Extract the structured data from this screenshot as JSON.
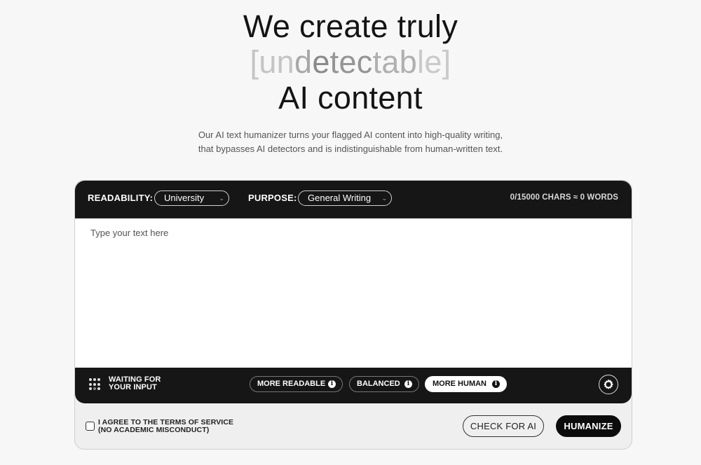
{
  "hero": {
    "line1": "We create truly",
    "accent": {
      "open": "[",
      "parts": [
        "un",
        "d",
        "e",
        "tec",
        "t",
        "ab",
        "le"
      ],
      "close": "]"
    },
    "line3": "AI content"
  },
  "subtitle": {
    "line1": "Our AI text humanizer turns your flagged AI content into high-quality writing,",
    "line2": "that bypasses AI detectors and is indistinguishable from human-written text."
  },
  "toolbar": {
    "readability_label": "READABILITY:",
    "readability_value": "University",
    "purpose_label": "PURPOSE:",
    "purpose_value": "General Writing",
    "counter": "0/15000 CHARS ≈ 0 WORDS"
  },
  "editor": {
    "placeholder": "Type your text here",
    "value": ""
  },
  "status": {
    "line1": "WAITING FOR",
    "line2": "YOUR INPUT",
    "icon": "dot-grid-icon"
  },
  "modes": [
    {
      "label": "MORE READABLE",
      "active": false,
      "icon": "info-icon"
    },
    {
      "label": "BALANCED",
      "active": false,
      "icon": "info-icon"
    },
    {
      "label": "MORE HUMAN",
      "active": true,
      "icon": "info-icon"
    }
  ],
  "settings_icon": "gear-icon",
  "footer": {
    "agree_line1": "I AGREE TO THE TERMS OF SERVICE",
    "agree_line2": "(NO ACADEMIC MISCONDUCT)",
    "agree_checked": false,
    "check_button": "CHECK FOR AI",
    "humanize_button": "HUMANIZE"
  },
  "colors": {
    "background": "#f7f7f7",
    "panel_dark": "#161616",
    "accent_text_light": "#c8c8c8",
    "primary_button": "#0c0c0c"
  }
}
